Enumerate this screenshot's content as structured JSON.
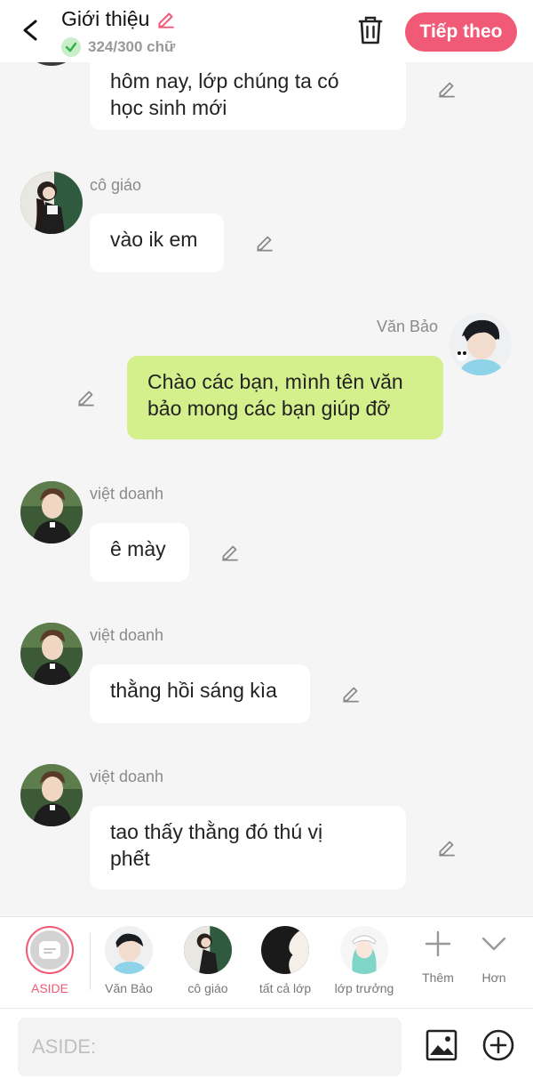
{
  "header": {
    "title": "Giới thiệu",
    "char_count": "324/300 chữ",
    "next_label": "Tiếp theo"
  },
  "messages": [
    {
      "sender": "",
      "text_lines": [
        "hôm nay, lớp chúng ta có",
        "học sinh mới"
      ],
      "mine": false
    },
    {
      "sender": "cô giáo",
      "text": "vào ik em",
      "mine": false
    },
    {
      "sender": "Văn Bảo",
      "text_lines": [
        "Chào các bạn, mình tên văn",
        "bảo mong các bạn giúp đỡ"
      ],
      "mine": true
    },
    {
      "sender": "việt doanh",
      "text": "ê mày",
      "mine": false
    },
    {
      "sender": "việt doanh",
      "text": "thằng hồi sáng kìa",
      "mine": false
    },
    {
      "sender": "việt doanh",
      "text_lines": [
        "tao thấy thằng đó thú vị",
        "phết"
      ],
      "mine": false
    }
  ],
  "characters": [
    {
      "label": "ASIDE",
      "selected": true
    },
    {
      "label": "Văn Bảo"
    },
    {
      "label": "cô giáo"
    },
    {
      "label": "tất cả lớp"
    },
    {
      "label": "lớp trưởng"
    },
    {
      "label": "Thêm",
      "icon": "plus-icon"
    },
    {
      "label": "Hơn",
      "icon": "chevron-down-icon"
    }
  ],
  "input": {
    "placeholder": "ASIDE:"
  },
  "colors": {
    "accent": "#f05a77",
    "my_bubble": "#d4f08c",
    "background": "#f5f5f5"
  }
}
